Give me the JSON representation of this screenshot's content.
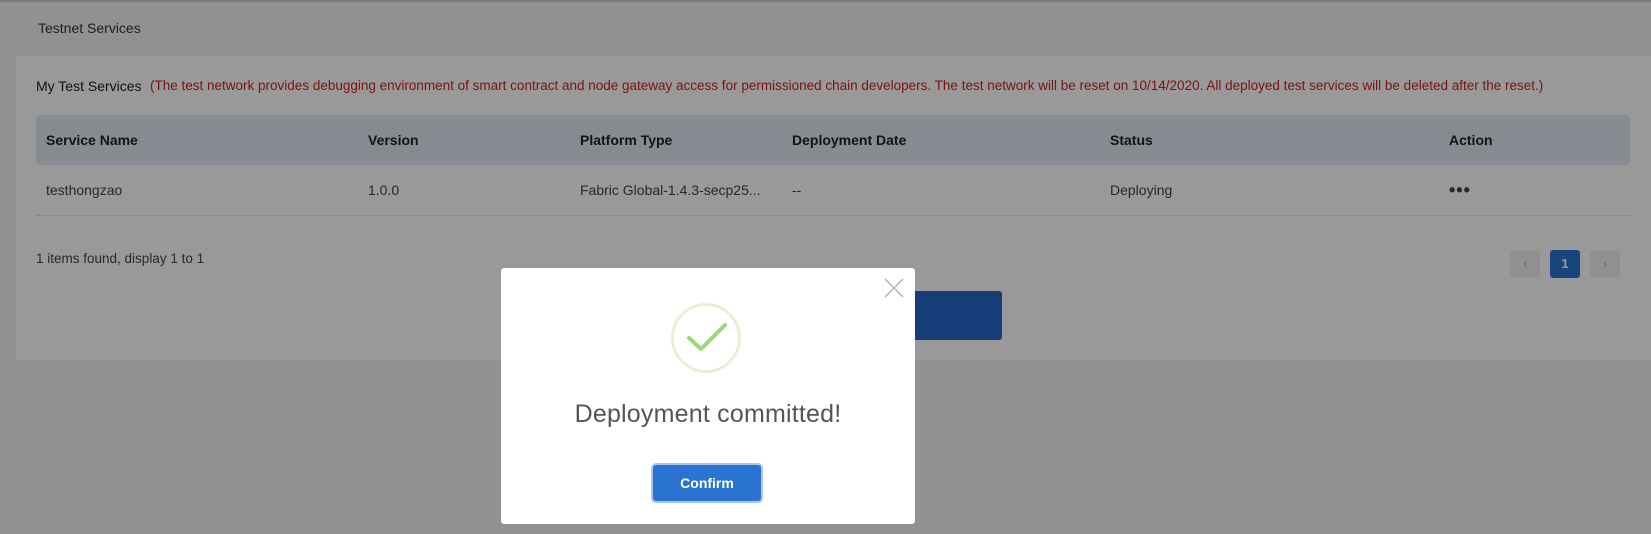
{
  "page": {
    "title": "Testnet Services"
  },
  "section": {
    "label": "My Test Services",
    "notice": "(The test network provides debugging environment of smart contract and node gateway access for permissioned chain developers. The test network will be reset on 10/14/2020. All deployed test services will be deleted after the reset.)"
  },
  "table": {
    "headers": [
      "Service Name",
      "Version",
      "Platform Type",
      "Deployment Date",
      "Status",
      "Action"
    ],
    "rows": [
      {
        "service_name": "testhongzao",
        "version": "1.0.0",
        "platform_type": "Fabric Global-1.4.3-secp25...",
        "deployment_date": "--",
        "status": "Deploying",
        "action_icon": "more-horizontal-icon"
      }
    ]
  },
  "pagination": {
    "summary": "1 items found, display 1 to 1",
    "current_page": "1"
  },
  "modal": {
    "icon": "check-circle-icon",
    "title": "Deployment committed!",
    "confirm_label": "Confirm",
    "close_icon": "close-icon"
  },
  "colors": {
    "primary": "#2b73d0",
    "notice_red": "#d0221f",
    "success_green": "#9ed67a",
    "header_bg": "#dfe6f2"
  }
}
